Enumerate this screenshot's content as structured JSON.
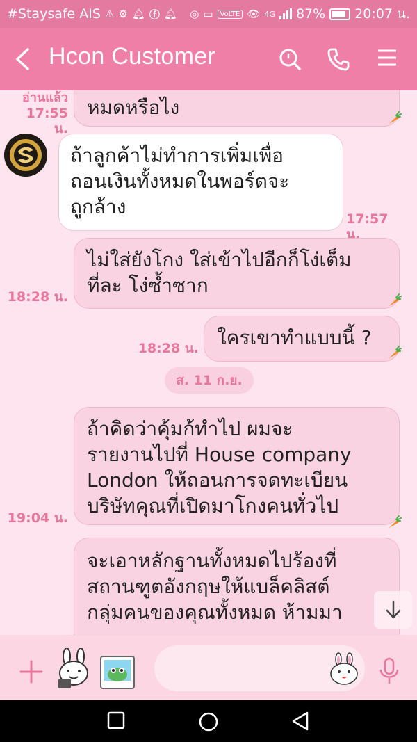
{
  "status_bar": {
    "carrier": "#Staysafe AIS",
    "network": "4G",
    "battery": "87%",
    "time": "20:07 น."
  },
  "header": {
    "title": "Hcon Customer"
  },
  "messages": [
    {
      "direction": "outgoing",
      "lines": [
        "หมดหรือไง"
      ],
      "read_label": "อ่านแล้ว",
      "time": "17:55 น."
    },
    {
      "direction": "incoming",
      "lines": [
        " ถ้าลูกค้าไม่ทำการเพิ่มเพื่อ",
        "ถอนเงินทั้งหมดในพอร์ตจะ",
        "ถูกล้าง"
      ],
      "time": "17:57 น."
    },
    {
      "direction": "outgoing",
      "lines": [
        "ไม่ใส่ยังโกง ใส่เข้าไปอีกก็โง่เต็ม",
        "ที่ละ โง่ซ้ำซาก"
      ],
      "time": "18:28 น."
    },
    {
      "direction": "outgoing",
      "lines": [
        "ใครเขาทำแบบนี้ ?"
      ],
      "time": "18:28 น."
    },
    {
      "direction": "outgoing",
      "lines": [
        "ถ้าคิดว่าคุ้มก้ทำไป ผมจะ",
        "รายงานไปที่ House company",
        "London  ให้ถอนการจดทะเบียน",
        "บริษัทคุณที่เปิดมาโกงคนทั่วไป"
      ],
      "time": "19:04 น."
    },
    {
      "direction": "outgoing",
      "lines": [
        "จะเอาหลักฐานทั้งหมดไปร้องที่",
        "สถานฑูตอังกฤษให้แบล็คลิสต์",
        "กลุ่มคนของคุณทั้งหมด ห้ามมา"
      ],
      "time": ""
    }
  ],
  "date_divider": "ส. 11 ก.ย.",
  "input": {
    "placeholder": ""
  },
  "colors": {
    "status_bar": "#e47aa0",
    "header": "#f07fa8",
    "chat_bg": "#fde4ee",
    "bubble_out": "#f9d3e1",
    "bubble_in": "#ffffff",
    "timestamp": "#e8779c"
  },
  "icons": {
    "header": [
      "back-arrow-icon",
      "search-icon",
      "phone-icon",
      "menu-icon"
    ],
    "input_bar": [
      "plus-icon",
      "sticker-icon",
      "photo-icon",
      "emoji-icon",
      "mic-icon"
    ],
    "navigation": [
      "recent-apps-icon",
      "home-icon",
      "back-icon"
    ]
  }
}
